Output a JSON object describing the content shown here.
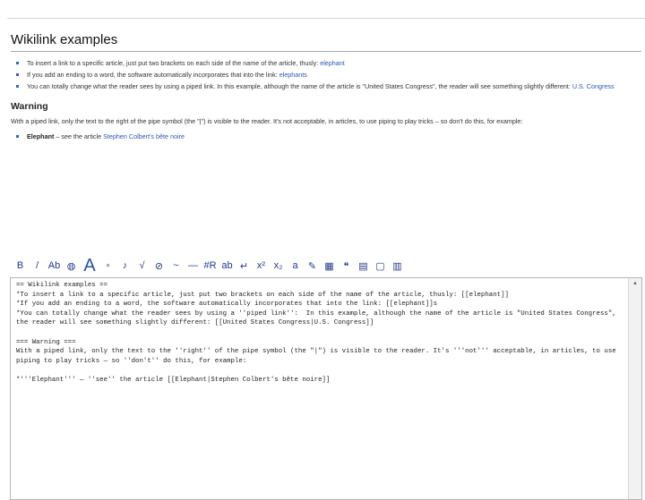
{
  "preview": {
    "heading": "Wikilink examples",
    "bullets": [
      {
        "text": "To insert a link to a specific article, just put two brackets on each side of the name of the article, thusly: ",
        "link": "elephant"
      },
      {
        "text": "If you add an ending to a word, the software automatically incorporates that into the link: ",
        "link": "elephants"
      },
      {
        "text": "You can totally change what the reader sees by using a piped link. In this example, although the name of the article is \"United States Congress\", the reader will see something slightly different: ",
        "link": "U.S. Congress"
      }
    ],
    "warning_heading": "Warning",
    "warning_para": "With a piped link, only the text to the right of the pipe symbol (the \"|\") is visible to the reader. It's not acceptable, in articles, to use piping to play tricks – so don't do this, for example:",
    "example_bold": "Elephant",
    "example_text": " – see the article ",
    "example_link": "Stephen Colbert's bête noire"
  },
  "toolbar": {
    "icons": [
      {
        "name": "bold-icon",
        "glyph": "B"
      },
      {
        "name": "italic-icon",
        "glyph": "/"
      },
      {
        "name": "internal-link-icon",
        "glyph": "Ab"
      },
      {
        "name": "globe-link-icon",
        "glyph": "◍"
      },
      {
        "name": "headline-icon",
        "glyph": "A"
      },
      {
        "name": "image-icon",
        "glyph": "▫"
      },
      {
        "name": "media-icon",
        "glyph": "♪"
      },
      {
        "name": "math-icon",
        "glyph": "√"
      },
      {
        "name": "nowiki-icon",
        "glyph": "⊘"
      },
      {
        "name": "signature-icon",
        "glyph": "~"
      },
      {
        "name": "horizontal-line-icon",
        "glyph": "—"
      },
      {
        "name": "redirect-icon",
        "glyph": "#R"
      },
      {
        "name": "strike-icon",
        "glyph": "ab"
      },
      {
        "name": "line-break-icon",
        "glyph": "↵"
      },
      {
        "name": "superscript-icon",
        "glyph": "x²"
      },
      {
        "name": "subscript-icon",
        "glyph": "x₂"
      },
      {
        "name": "small-text-icon",
        "glyph": "a"
      },
      {
        "name": "comment-icon",
        "glyph": "✎"
      },
      {
        "name": "gallery-icon",
        "glyph": "▦"
      },
      {
        "name": "quote-icon",
        "glyph": "❝"
      },
      {
        "name": "table-icon",
        "glyph": "▤"
      },
      {
        "name": "box-icon",
        "glyph": "▢"
      },
      {
        "name": "grid-icon",
        "glyph": "▥"
      }
    ]
  },
  "editor": {
    "content": "== Wikilink examples ==\n*To insert a link to a specific article, just put two brackets on each side of the name of the article, thusly: [[elephant]]\n*If you add an ending to a word, the software automatically incorporates that into the link: [[elephant]]s\n*You can totally change what the reader sees by using a ''piped link'':  In this example, although the name of the article is \"United States Congress\", the reader will see something slightly different: [[United States Congress|U.S. Congress]]\n\n=== Warning ===\nWith a piped link, only the text to the ''right'' of the pipe symbol (the \"|\") is visible to the reader. It's '''not''' acceptable, in articles, to use piping to play tricks — so ''don't'' do this, for example:\n\n*'''Elephant''' — ''see'' the article [[Elephant|Stephen Colbert's bête noire]]"
  }
}
